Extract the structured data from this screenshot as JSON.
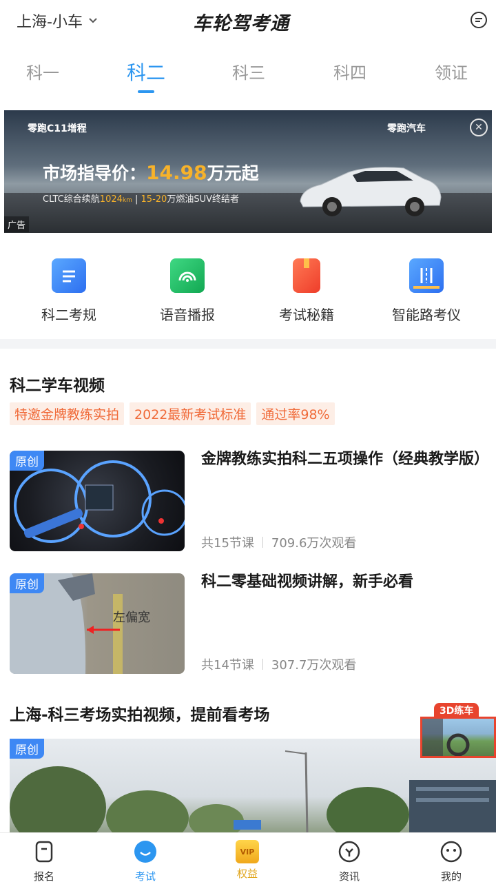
{
  "header": {
    "city": "上海-小车",
    "logo": "车轮驾考通",
    "icons": {
      "dropdown": "chevron-down-icon",
      "message": "message-icon"
    }
  },
  "tabs": [
    {
      "label": "科一"
    },
    {
      "label": "科二",
      "active": true
    },
    {
      "label": "科三"
    },
    {
      "label": "科四"
    },
    {
      "label": "领证"
    }
  ],
  "banner": {
    "brand_left": "零跑C11增程",
    "brand_right": "零跑汽车",
    "price_prefix": "市场指导价：",
    "price_value": "14.98",
    "price_suffix": "万元起",
    "spec_prefix": "CLTC综合续航",
    "spec_range": "1024",
    "spec_unit": "km",
    "spec_mid": "15-20",
    "spec_suffix": "万燃油SUV终结者",
    "ad_label": "广告",
    "close_glyph": "✕"
  },
  "quick_entries": [
    {
      "label": "科二考规",
      "icon": "rules-doc-icon",
      "color": "#3d8ef5"
    },
    {
      "label": "语音播报",
      "icon": "voice-broadcast-icon",
      "color": "#1fbf65"
    },
    {
      "label": "考试秘籍",
      "icon": "secret-book-icon",
      "color": "#f5563b"
    },
    {
      "label": "智能路考仪",
      "icon": "road-test-device-icon",
      "color": "#3d8ef5"
    }
  ],
  "section1": {
    "title": "科二学车视频",
    "tags": [
      "特邀金牌教练实拍",
      "2022最新考试标准",
      "通过率98%"
    ]
  },
  "videos": [
    {
      "badge": "原创",
      "title": "金牌教练实拍科二五项操作（经典教学版）",
      "lessons": "共15节课",
      "views": "709.6万次观看"
    },
    {
      "badge": "原创",
      "title": "科二零基础视频讲解，新手必看",
      "lessons": "共14节课",
      "views": "307.7万次观看",
      "overlay_text": "左偏宽"
    }
  ],
  "section2": {
    "title": "上海-科三考场实拍视频，提前看考场",
    "badge": "原创"
  },
  "float_ad": {
    "label": "3D练车"
  },
  "bottom_nav": [
    {
      "label": "报名",
      "icon": "signup-icon"
    },
    {
      "label": "考试",
      "icon": "exam-icon",
      "active": true
    },
    {
      "label": "权益",
      "icon": "vip-crown-icon",
      "badge": "VIP"
    },
    {
      "label": "资讯",
      "icon": "news-icon"
    },
    {
      "label": "我的",
      "icon": "profile-icon"
    }
  ],
  "colors": {
    "accent": "#2c96f0",
    "tag_bg": "#fdeee6",
    "tag_text": "#f06b3a",
    "badge": "#3e88f4",
    "vip": "#e0a419"
  }
}
